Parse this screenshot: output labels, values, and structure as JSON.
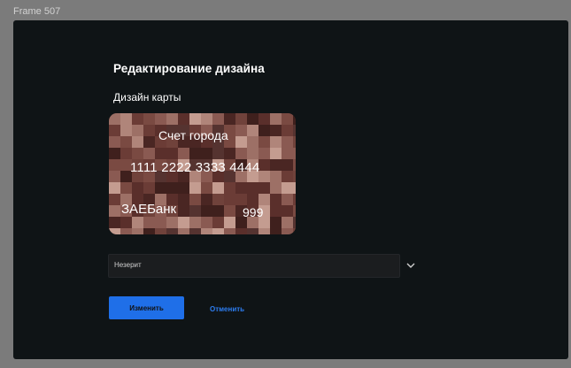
{
  "frame": {
    "label": "Frame 507"
  },
  "editor": {
    "title": "Редактирование дизайна",
    "section_label": "Дизайн карты"
  },
  "card": {
    "title": "Счет города",
    "number": "1111 2222 3333 4444",
    "bank": "ЗАЕБанк",
    "cvv": "999"
  },
  "design_select": {
    "value": "Незерит",
    "icon": "chevron-down-icon"
  },
  "actions": {
    "apply_label": "Изменить",
    "cancel_label": "Отменить"
  },
  "colors": {
    "background": "#0f1416",
    "accent": "#1f6fe8",
    "link": "#2d7df0"
  }
}
